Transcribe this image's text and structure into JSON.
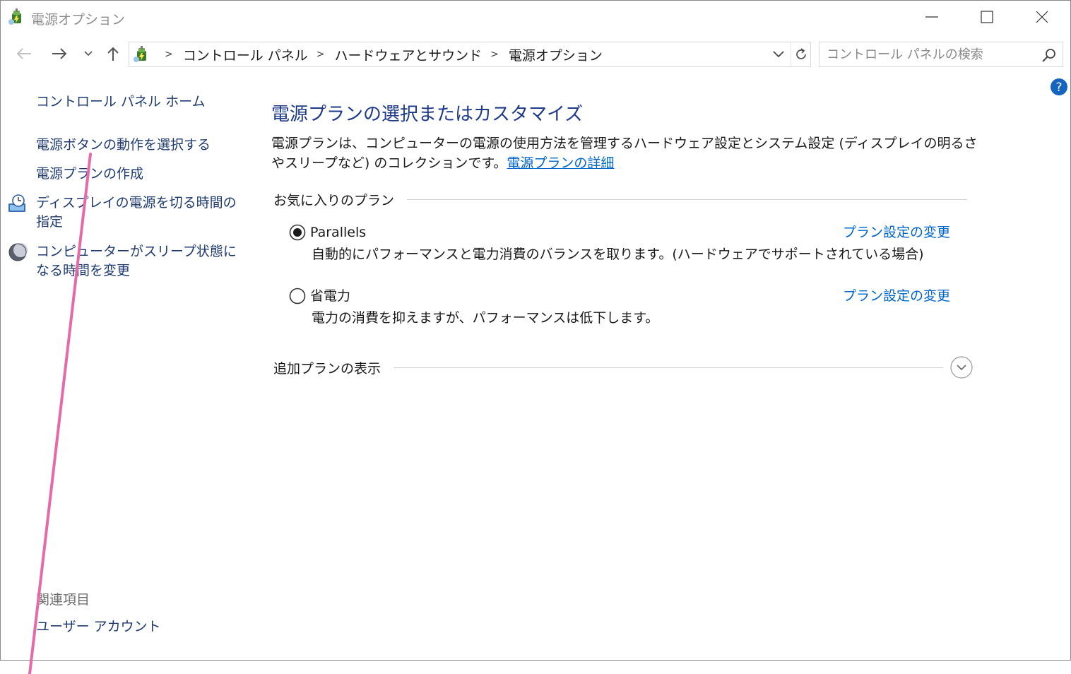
{
  "window": {
    "title": "電源オプション",
    "icon": "power-options-icon"
  },
  "nav": {
    "back_icon": "back-arrow-icon",
    "forward_icon": "forward-arrow-icon",
    "recent_icon": "chevron-down-icon",
    "up_icon": "up-arrow-icon",
    "breadcrumbs": [
      {
        "label": "コントロール パネル"
      },
      {
        "label": "ハードウェアとサウンド"
      },
      {
        "label": "電源オプション"
      }
    ],
    "separator": ">",
    "search_placeholder": "コントロール パネルの検索"
  },
  "sidebar": {
    "home": "コントロール パネル ホーム",
    "items": [
      {
        "label": "電源ボタンの動作を選択する"
      },
      {
        "label": "電源プランの作成"
      },
      {
        "label": "ディスプレイの電源を切る時間の指定",
        "icon": "display-clock-icon"
      },
      {
        "label": "コンピューターがスリープ状態になる時間を変更",
        "icon": "moon-sleep-icon"
      }
    ],
    "related_title": "関連項目",
    "related": [
      {
        "label": "ユーザー アカウント"
      }
    ]
  },
  "main": {
    "title": "電源プランの選択またはカスタマイズ",
    "description": "電源プランは、コンピューターの電源の使用方法を管理するハードウェア設定とシステム設定 (ディスプレイの明るさやスリープなど) のコレクションです。",
    "more_link": "電源プランの詳細",
    "favorites_header": "お気に入りのプラン",
    "plans": [
      {
        "name": "Parallels",
        "description": "自動的にパフォーマンスと電力消費のバランスを取ります。(ハードウェアでサポートされている場合)",
        "change_link": "プラン設定の変更",
        "selected": true
      },
      {
        "name": "省電力",
        "description": "電力の消費を抑えますが、パフォーマンスは低下します。",
        "change_link": "プラン設定の変更",
        "selected": false
      }
    ],
    "extra_header": "追加プランの表示"
  },
  "colors": {
    "accent_link": "#0066cc",
    "title_blue": "#1e3a8a",
    "annotation": "#e66aa8"
  }
}
